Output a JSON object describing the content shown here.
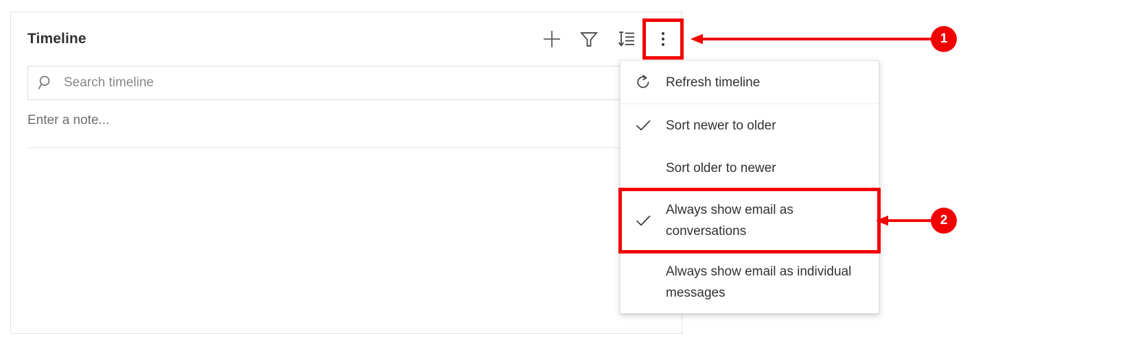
{
  "panel": {
    "title": "Timeline",
    "toolbar": [
      {
        "name": "add-icon",
        "label": "Add"
      },
      {
        "name": "filter-icon",
        "label": "Filter"
      },
      {
        "name": "sort-icon",
        "label": "Sort"
      },
      {
        "name": "more-options-icon",
        "label": "More commands"
      }
    ],
    "search": {
      "placeholder": "Search timeline",
      "value": "",
      "icon": "search-icon"
    },
    "note": {
      "placeholder": "Enter a note..."
    }
  },
  "menu": {
    "items": [
      {
        "label": "Refresh timeline",
        "icon": "refresh-icon",
        "checked": false
      },
      {
        "label": "Sort newer to older",
        "icon": "check-icon",
        "checked": true
      },
      {
        "label": "Sort older to newer",
        "icon": "",
        "checked": false
      },
      {
        "label": "Always show email as conversations",
        "icon": "check-icon",
        "checked": true
      },
      {
        "label": "Always show email as individual messages",
        "icon": "",
        "checked": false
      }
    ]
  },
  "annotations": {
    "accent_color": "#f20000",
    "badges": [
      {
        "number": "1",
        "target": "more-options-icon"
      },
      {
        "number": "2",
        "target": "always-show-email-as-conversations"
      }
    ]
  }
}
